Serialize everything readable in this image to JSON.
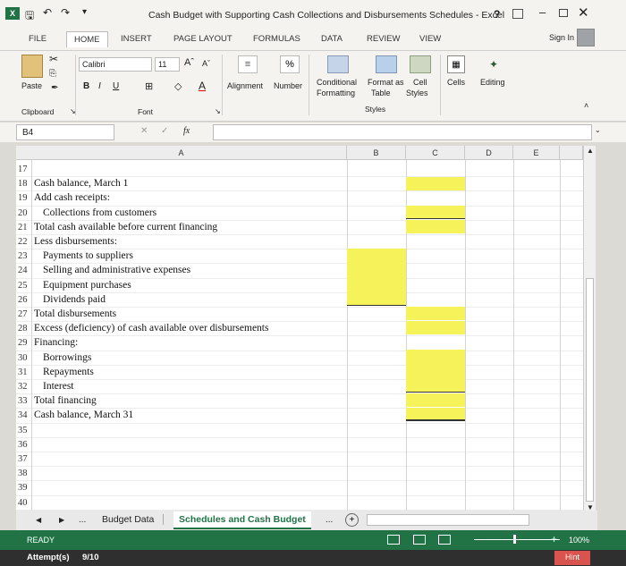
{
  "title": "Cash Budget with Supporting Cash Collections and Disbursements Schedules - Excel",
  "window": {
    "help": "?",
    "sign_in": "Sign In"
  },
  "tabs": [
    "FILE",
    "HOME",
    "INSERT",
    "PAGE LAYOUT",
    "FORMULAS",
    "DATA",
    "REVIEW",
    "VIEW"
  ],
  "ribbon": {
    "paste": "Paste",
    "font_name": "Calibri",
    "font_size": "11",
    "bold": "B",
    "italic": "I",
    "underline": "U",
    "alignment": "Alignment",
    "number": "Number",
    "percent": "%",
    "conditional": "Conditional",
    "formatting": "Formatting",
    "format_as": "Format as",
    "table": "Table",
    "cell": "Cell",
    "styles_btn": "Styles",
    "cells": "Cells",
    "editing": "Editing",
    "groups": {
      "clipboard": "Clipboard",
      "font": "Font",
      "styles": "Styles"
    }
  },
  "formula_bar": {
    "name_box": "B4",
    "fx": "fx",
    "content": ""
  },
  "columns": [
    "A",
    "B",
    "C",
    "D",
    "E"
  ],
  "rows": [
    {
      "n": "17",
      "text": "",
      "indent": 0
    },
    {
      "n": "18",
      "text": "Cash balance, March 1",
      "indent": 0
    },
    {
      "n": "19",
      "text": "Add cash receipts:",
      "indent": 0
    },
    {
      "n": "20",
      "text": "Collections from customers",
      "indent": 1
    },
    {
      "n": "21",
      "text": "Total cash available before current financing",
      "indent": 0
    },
    {
      "n": "22",
      "text": "Less disbursements:",
      "indent": 0
    },
    {
      "n": "23",
      "text": "Payments to suppliers",
      "indent": 1
    },
    {
      "n": "24",
      "text": "Selling and administrative expenses",
      "indent": 1
    },
    {
      "n": "25",
      "text": "Equipment purchases",
      "indent": 1
    },
    {
      "n": "26",
      "text": "Dividends paid",
      "indent": 1
    },
    {
      "n": "27",
      "text": "Total disbursements",
      "indent": 0
    },
    {
      "n": "28",
      "text": "Excess (deficiency) of cash available over disbursements",
      "indent": 0
    },
    {
      "n": "29",
      "text": "Financing:",
      "indent": 0
    },
    {
      "n": "30",
      "text": "Borrowings",
      "indent": 1
    },
    {
      "n": "31",
      "text": "Repayments",
      "indent": 1
    },
    {
      "n": "32",
      "text": "Interest",
      "indent": 1
    },
    {
      "n": "33",
      "text": "Total financing",
      "indent": 0
    },
    {
      "n": "34",
      "text": "Cash balance, March 31",
      "indent": 0
    },
    {
      "n": "35",
      "text": "",
      "indent": 0
    },
    {
      "n": "36",
      "text": "",
      "indent": 0
    },
    {
      "n": "37",
      "text": "",
      "indent": 0
    },
    {
      "n": "38",
      "text": "",
      "indent": 0
    },
    {
      "n": "39",
      "text": "",
      "indent": 0
    },
    {
      "n": "40",
      "text": "",
      "indent": 0
    }
  ],
  "sheets": {
    "tab1": "Budget Data",
    "tab2": "Schedules and Cash Budget",
    "more": "..."
  },
  "status": {
    "ready": "READY",
    "zoom": "100%"
  },
  "attempts": {
    "label": "Attempt(s)",
    "value": "9/10",
    "hint": "Hint"
  },
  "colors": {
    "excel_green": "#217346",
    "highlight": "#f6f25a"
  }
}
